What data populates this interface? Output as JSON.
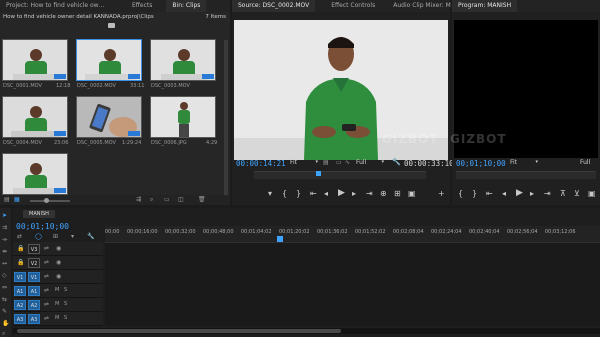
{
  "project_panel": {
    "tabs": [
      {
        "label": "Project: How to find vehicle owner detail KANNADA"
      },
      {
        "label": "Effects"
      },
      {
        "label": "Bin: Clips"
      }
    ],
    "bin_path": "How to find vehicle owner detail KANNADA.prproj\\Clips",
    "item_count": "7 Items",
    "clips": [
      {
        "name": "DSC_0001.MOV",
        "duration": "12:18"
      },
      {
        "name": "DSC_0002.MOV",
        "duration": "33:11"
      },
      {
        "name": "DSC_0003.MOV",
        "duration": ""
      },
      {
        "name": "DSC_0004.MOV",
        "duration": "23:06"
      },
      {
        "name": "DSC_0005.MOV",
        "duration": "1:29:24"
      },
      {
        "name": "DSC_0006.JPG",
        "duration": "4:29"
      },
      {
        "name": "",
        "duration": ""
      }
    ]
  },
  "source_panel": {
    "tabs": [
      {
        "label": "Source: DSC_0002.MOV"
      },
      {
        "label": "Effect Controls"
      },
      {
        "label": "Audio Clip Mixer: M"
      }
    ],
    "current_time": "00:00:14:21",
    "fit": "Fit",
    "resolution": "Full",
    "duration": "00:00:33:10"
  },
  "program_panel": {
    "tab": "Program: MANISH",
    "current_time": "00;01;10;00",
    "fit": "Fit",
    "resolution": "Full"
  },
  "timeline": {
    "sequence_tab": "MANISH",
    "current_time": "00;01;10;00",
    "ruler_labels": [
      "00;00",
      "00;00;16;00",
      "00;00;32;00",
      "00;00;48;00",
      "00;01;04;02",
      "00;01;20;02",
      "00;01;36;02",
      "00;01;52;02",
      "00;02;08;04",
      "00;02;24;04",
      "00;02;40;04",
      "00;02;56;04",
      "00;03;12;06"
    ],
    "tracks": [
      {
        "patch": "",
        "name": "V3",
        "type": "video"
      },
      {
        "patch": "",
        "name": "V2",
        "type": "video"
      },
      {
        "patch": "V1",
        "name": "V1",
        "type": "video"
      },
      {
        "patch": "A1",
        "name": "A1",
        "type": "audio",
        "m": "M",
        "s": "S"
      },
      {
        "patch": "A2",
        "name": "A2",
        "type": "audio",
        "m": "M",
        "s": "S"
      },
      {
        "patch": "A3",
        "name": "A3",
        "type": "audio",
        "m": "M",
        "s": "S"
      }
    ]
  },
  "watermark": "GIZBOT",
  "colors": {
    "accent": "#3fa4ff",
    "selected_track": "#1f5f9c",
    "panel_bg": "#262626",
    "playhead": "#3fa4ff"
  }
}
